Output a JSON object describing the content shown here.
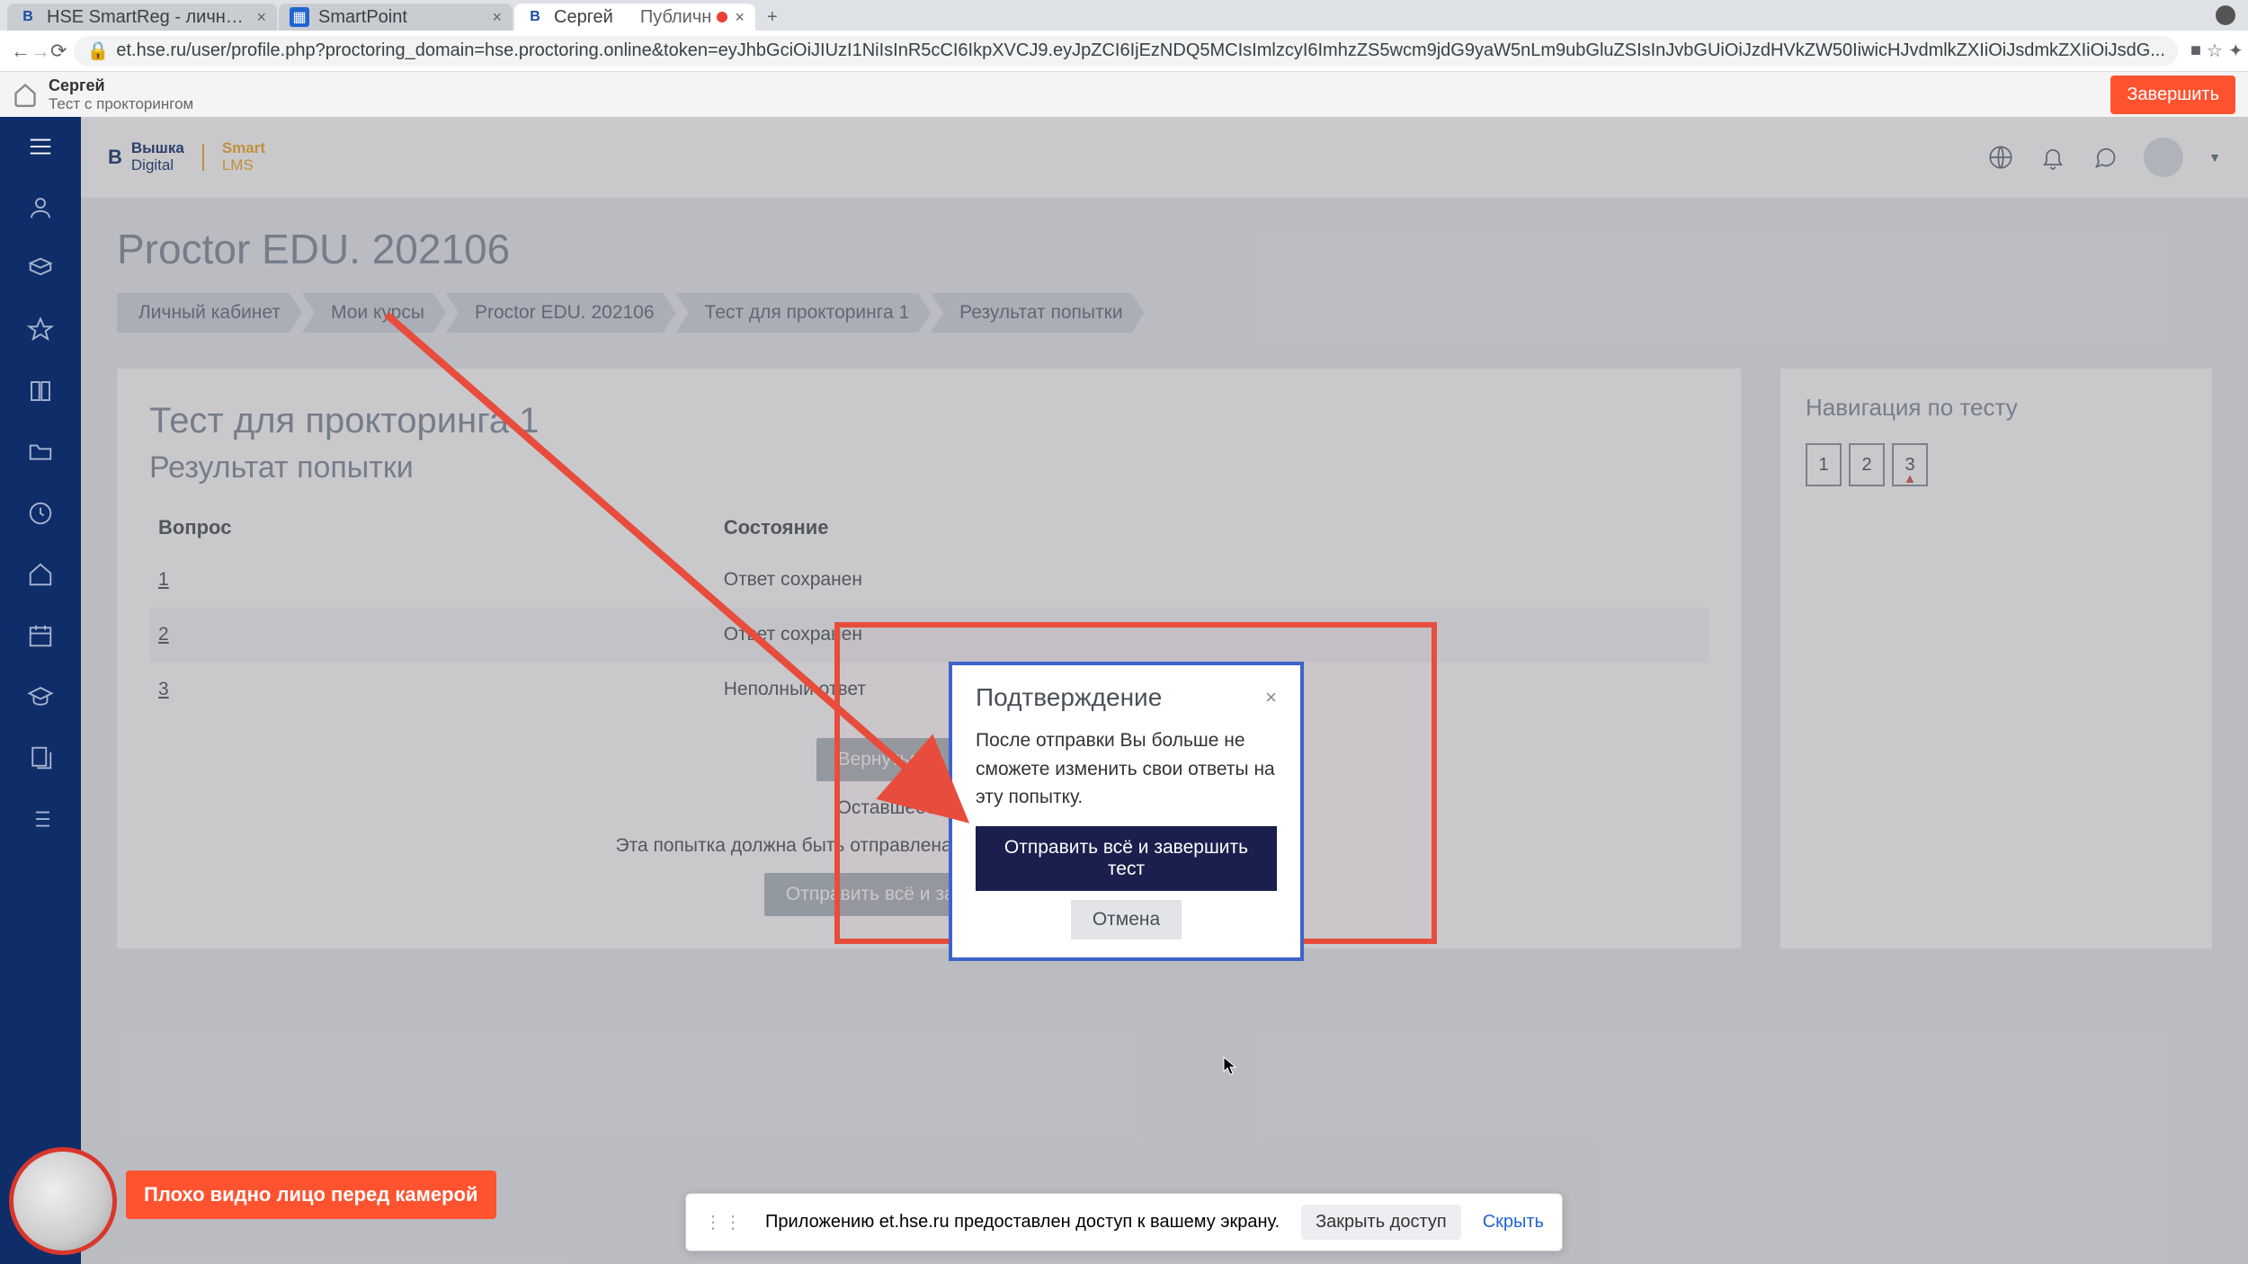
{
  "browser": {
    "tabs": [
      {
        "title": "HSE SmartReg - личный каби",
        "favicon": "B"
      },
      {
        "title": "SmartPoint",
        "favicon": "▦"
      },
      {
        "title": "Сергей",
        "extra": "Публичн",
        "favicon": "B",
        "recording": true,
        "active": true
      }
    ],
    "url": "et.hse.ru/user/profile.php?proctoring_domain=hse.proctoring.online&token=eyJhbGciOiJIUzI1NiIsInR5cCI6IkpXVCJ9.eyJpZCI6IjEzNDQ5MCIsImlzcyI6ImhzZS5wcm9jdG9yaW5nLm9ubGluZSIsInJvbGUiOiJzdHVkZW50IiwicHJvdmlkZXIiOiJsdmkZXIiOiJsdG..."
  },
  "proctor_bar": {
    "name": "Сергей",
    "sub": "Тест с прокторингом",
    "finish": "Завершить"
  },
  "logo": {
    "line1": "Вышка",
    "line2": "Digital",
    "line3": "Smart",
    "line4": "LMS"
  },
  "page": {
    "course": "Proctor EDU. 202106",
    "breadcrumb": [
      "Личный кабинет",
      "Мои курсы",
      "Proctor EDU. 202106",
      "Тест для прокторинга 1",
      "Результат попытки"
    ],
    "quiz_title": "Тест для прокторинга 1",
    "quiz_sub": "Результат попытки",
    "th_q": "Вопрос",
    "th_state": "Состояние",
    "rows": [
      {
        "q": "1",
        "state": "Ответ сохранен"
      },
      {
        "q": "2",
        "state": "Ответ сохранен"
      },
      {
        "q": "3",
        "state": "Неполный ответ"
      }
    ],
    "return_btn": "Вернуться к попытке",
    "time_left": "Оставшееся время 2",
    "deadline": "Эта попытка должна быть отправлена до Tuesday, 29 June 2021, 00:08.",
    "submit_btn": "Отправить всё и завершить тест"
  },
  "qnav": {
    "title": "Навигация по тесту",
    "items": [
      "1",
      "2",
      "3"
    ]
  },
  "modal": {
    "title": "Подтверждение",
    "body": "После отправки Вы больше не сможете изменить свои ответы на эту попытку.",
    "confirm": "Отправить всё и завершить тест",
    "cancel": "Отмена"
  },
  "camera_warn": "Плохо видно лицо перед камерой",
  "share": {
    "msg": "Приложению et.hse.ru предоставлен доступ к вашему экрану.",
    "stop": "Закрыть доступ",
    "hide": "Скрыть"
  }
}
